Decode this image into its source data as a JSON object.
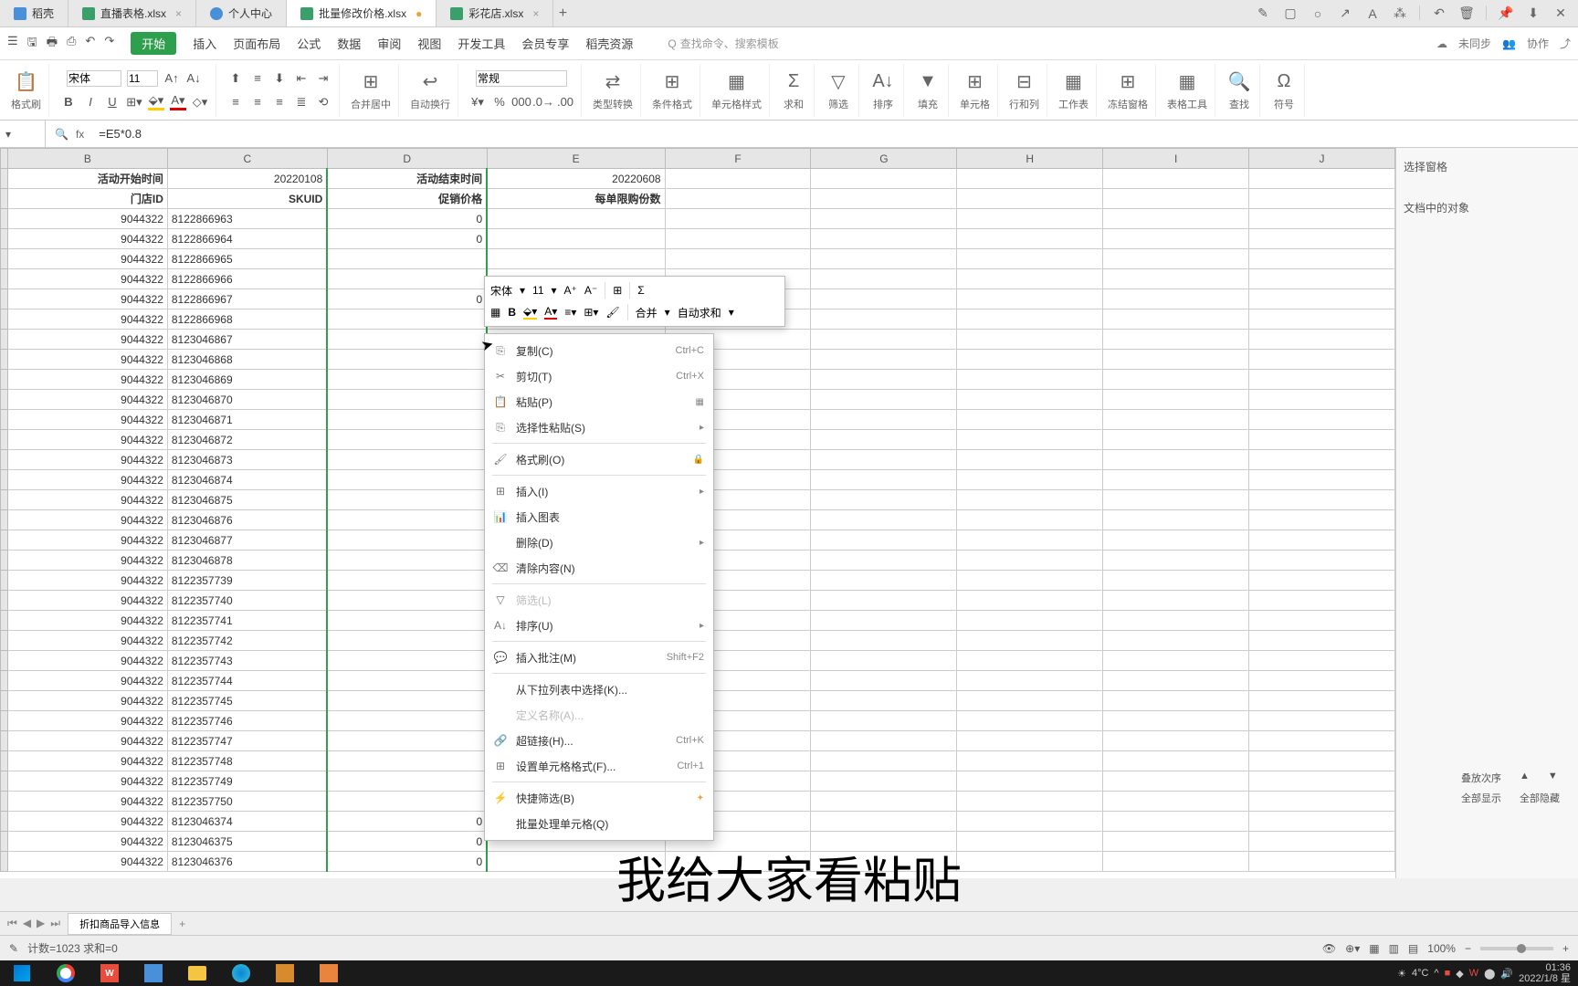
{
  "tabs": [
    {
      "label": "稻壳",
      "icon": "doc"
    },
    {
      "label": "直播表格.xlsx",
      "icon": "sheet"
    },
    {
      "label": "个人中心",
      "icon": "person"
    },
    {
      "label": "批量修改价格.xlsx",
      "icon": "sheet",
      "active": true
    },
    {
      "label": "彩花店.xlsx",
      "icon": "sheet"
    }
  ],
  "menu": {
    "items": [
      "开始",
      "插入",
      "页面布局",
      "公式",
      "数据",
      "审阅",
      "视图",
      "开发工具",
      "会员专享",
      "稻壳资源"
    ],
    "search_placeholder": "查找命令、搜索模板",
    "search_icon_label": "Q",
    "right": [
      "未同步",
      "协作",
      "分享"
    ]
  },
  "toolbar": {
    "format_painter": "格式刷",
    "font_name": "宋体",
    "font_size": "11",
    "merge": "合并居中",
    "wrap": "自动换行",
    "number_format": "常规",
    "convert": "类型转换",
    "cond_format": "条件格式",
    "cell_style": "单元格样式",
    "sum": "求和",
    "filter": "筛选",
    "sort": "排序",
    "fill": "填充",
    "cells": "单元格",
    "rowcol": "行和列",
    "worksheet": "工作表",
    "freeze": "冻结窗格",
    "table_tools": "表格工具",
    "find": "查找",
    "symbol": "符号"
  },
  "formula_bar": {
    "name_box": "",
    "fx": "fx",
    "value": "=E5*0.8"
  },
  "columns": [
    "B",
    "C",
    "D",
    "E",
    "F",
    "G",
    "H",
    "I",
    "J"
  ],
  "headers": {
    "B": "活动开始时间",
    "C": "20220108",
    "D": "活动结束时间",
    "E": "20220608",
    "B2": "门店ID",
    "C2": "SKUID",
    "D2": "促销价格",
    "E2": "每单限购份数"
  },
  "rows": [
    {
      "b": "9044322",
      "c": "8122866963",
      "d": "0"
    },
    {
      "b": "9044322",
      "c": "8122866964",
      "d": "0"
    },
    {
      "b": "9044322",
      "c": "8122866965",
      "d": ""
    },
    {
      "b": "9044322",
      "c": "8122866966",
      "d": ""
    },
    {
      "b": "9044322",
      "c": "8122866967",
      "d": "0"
    },
    {
      "b": "9044322",
      "c": "8122866968",
      "d": ""
    },
    {
      "b": "9044322",
      "c": "8123046867",
      "d": ""
    },
    {
      "b": "9044322",
      "c": "8123046868",
      "d": ""
    },
    {
      "b": "9044322",
      "c": "8123046869",
      "d": ""
    },
    {
      "b": "9044322",
      "c": "8123046870",
      "d": ""
    },
    {
      "b": "9044322",
      "c": "8123046871",
      "d": ""
    },
    {
      "b": "9044322",
      "c": "8123046872",
      "d": ""
    },
    {
      "b": "9044322",
      "c": "8123046873",
      "d": ""
    },
    {
      "b": "9044322",
      "c": "8123046874",
      "d": ""
    },
    {
      "b": "9044322",
      "c": "8123046875",
      "d": ""
    },
    {
      "b": "9044322",
      "c": "8123046876",
      "d": ""
    },
    {
      "b": "9044322",
      "c": "8123046877",
      "d": ""
    },
    {
      "b": "9044322",
      "c": "8123046878",
      "d": ""
    },
    {
      "b": "9044322",
      "c": "8122357739",
      "d": ""
    },
    {
      "b": "9044322",
      "c": "8122357740",
      "d": ""
    },
    {
      "b": "9044322",
      "c": "8122357741",
      "d": ""
    },
    {
      "b": "9044322",
      "c": "8122357742",
      "d": ""
    },
    {
      "b": "9044322",
      "c": "8122357743",
      "d": ""
    },
    {
      "b": "9044322",
      "c": "8122357744",
      "d": ""
    },
    {
      "b": "9044322",
      "c": "8122357745",
      "d": ""
    },
    {
      "b": "9044322",
      "c": "8122357746",
      "d": ""
    },
    {
      "b": "9044322",
      "c": "8122357747",
      "d": ""
    },
    {
      "b": "9044322",
      "c": "8122357748",
      "d": ""
    },
    {
      "b": "9044322",
      "c": "8122357749",
      "d": ""
    },
    {
      "b": "9044322",
      "c": "8122357750",
      "d": ""
    },
    {
      "b": "9044322",
      "c": "8123046374",
      "d": "0"
    },
    {
      "b": "9044322",
      "c": "8123046375",
      "d": "0"
    },
    {
      "b": "9044322",
      "c": "8123046376",
      "d": "0"
    }
  ],
  "task_pane": {
    "title": "选择窗格",
    "subtitle": "文档中的对象",
    "stack_order": "叠放次序",
    "show_all": "全部显示",
    "hide_all": "全部隐藏"
  },
  "mini_toolbar": {
    "font": "宋体",
    "size": "11",
    "merge": "合并",
    "autosum": "自动求和"
  },
  "context_menu": {
    "copy": {
      "label": "复制(C)",
      "key": "Ctrl+C"
    },
    "cut": {
      "label": "剪切(T)",
      "key": "Ctrl+X"
    },
    "paste": {
      "label": "粘贴(P)"
    },
    "paste_special": {
      "label": "选择性粘贴(S)"
    },
    "format_painter": {
      "label": "格式刷(O)"
    },
    "insert": {
      "label": "插入(I)"
    },
    "insert_chart": {
      "label": "插入图表"
    },
    "delete": {
      "label": "删除(D)"
    },
    "clear": {
      "label": "清除内容(N)"
    },
    "filter": {
      "label": "筛选(L)"
    },
    "sort": {
      "label": "排序(U)"
    },
    "comment": {
      "label": "插入批注(M)",
      "key": "Shift+F2"
    },
    "dropdown": {
      "label": "从下拉列表中选择(K)..."
    },
    "define_name": {
      "label": "定义名称(A)..."
    },
    "hyperlink": {
      "label": "超链接(H)...",
      "key": "Ctrl+K"
    },
    "format_cells": {
      "label": "设置单元格格式(F)...",
      "key": "Ctrl+1"
    },
    "quick_filter": {
      "label": "快捷筛选(B)"
    },
    "batch": {
      "label": "批量处理单元格(Q)"
    }
  },
  "subtitle": "我给大家看粘贴",
  "sheet_tab": "折扣商品导入信息",
  "status": {
    "left": "计数=1023  求和=0",
    "zoom": "100%"
  },
  "taskbar": {
    "temp": "4°C",
    "time": "01:36",
    "date": "2022/1/8 星"
  }
}
